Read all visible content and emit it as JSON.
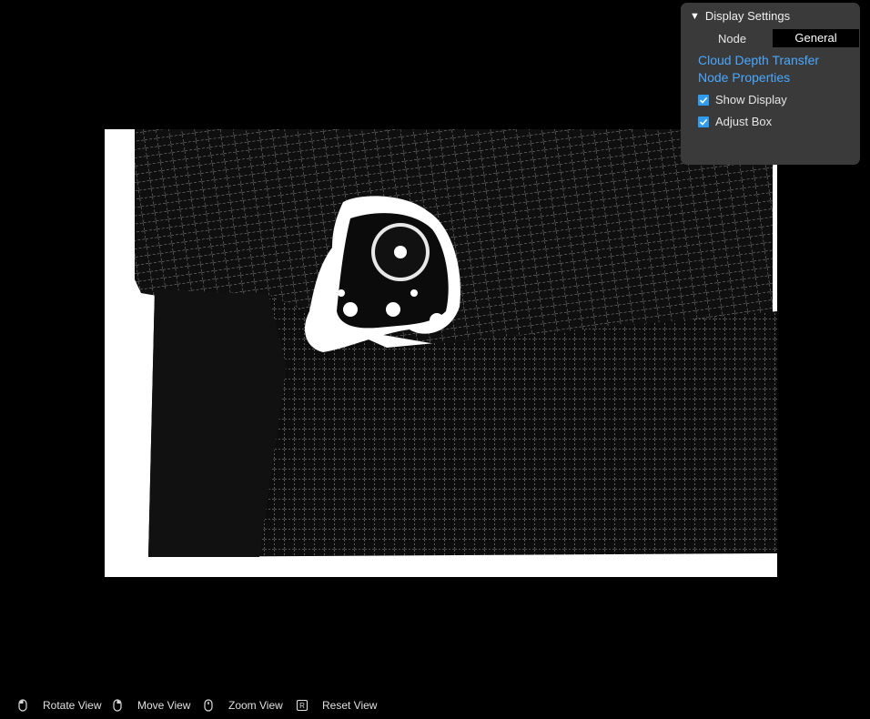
{
  "panel": {
    "title": "Display Settings",
    "node_label": "Node",
    "node_value": "General",
    "links": [
      "Cloud Depth Transfer",
      "Node Properties"
    ],
    "checks": [
      {
        "label": "Show Display",
        "checked": true
      },
      {
        "label": "Adjust Box",
        "checked": true
      }
    ],
    "accent_color": "#2f9cf2",
    "link_color": "#4aa8ff"
  },
  "hints": [
    {
      "icon": "mouse-left-icon",
      "label": "Rotate View"
    },
    {
      "icon": "mouse-right-icon",
      "label": "Move View"
    },
    {
      "icon": "mouse-wheel-icon",
      "label": "Zoom View"
    },
    {
      "icon": "key-r-icon",
      "label": "Reset View",
      "key": "R"
    }
  ],
  "viewport": {
    "background": "#000000",
    "frame_color": "#ffffff"
  }
}
